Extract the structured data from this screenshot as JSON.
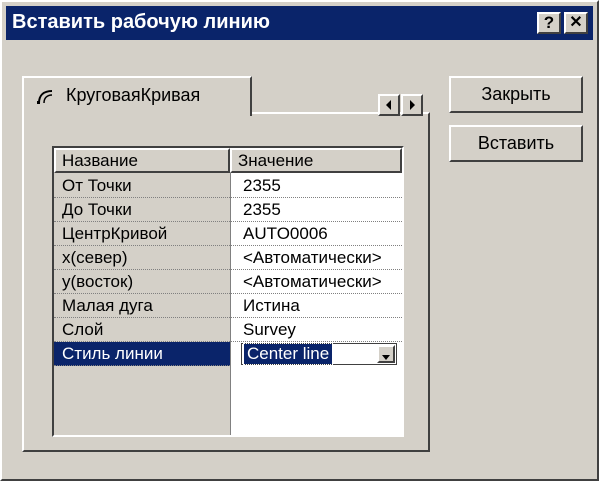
{
  "window": {
    "title": "Вставить рабочую линию",
    "help_label": "?",
    "close_label": "✕"
  },
  "tab": {
    "label": "КруговаяКривая",
    "icon": "curve-icon"
  },
  "tab_scroll": {
    "left_icon": "arrow-left-icon",
    "right_icon": "arrow-right-icon"
  },
  "buttons": {
    "close_label": "Закрыть",
    "insert_label": "Вставить"
  },
  "grid": {
    "header_name": "Название",
    "header_value": "Значение",
    "rows": [
      {
        "name": "От Точки",
        "value": "2355"
      },
      {
        "name": "До Точки",
        "value": "2355"
      },
      {
        "name": "ЦентрКривой",
        "value": "AUTO0006"
      },
      {
        "name": "x(север)",
        "value": "<Автоматически>"
      },
      {
        "name": "y(восток)",
        "value": "<Автоматически>"
      },
      {
        "name": "Малая дуга",
        "value": "Истина"
      },
      {
        "name": "Слой",
        "value": "Survey"
      },
      {
        "name": "Стиль линии",
        "value": "Center line",
        "selected": true
      }
    ]
  },
  "colors": {
    "title_bar": "#0a246a",
    "face": "#d4d0c8",
    "selection": "#0a246a"
  }
}
